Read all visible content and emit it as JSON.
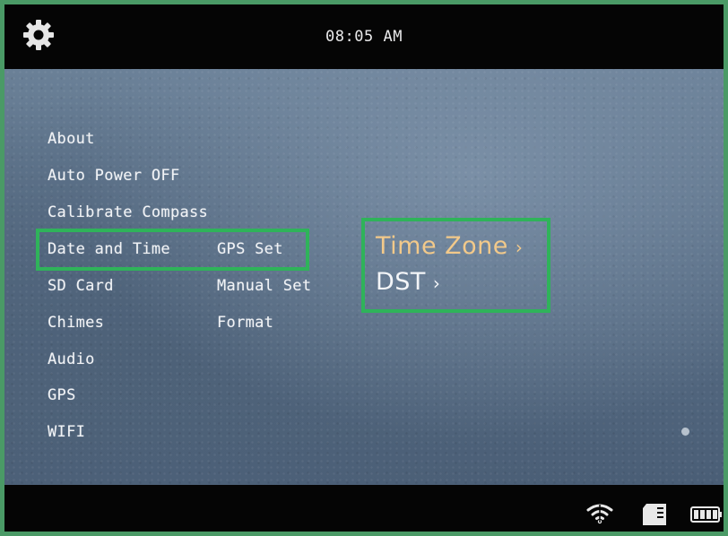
{
  "status_bar": {
    "time": "08:05 AM",
    "settings_icon": "gear-icon"
  },
  "menu": {
    "items": [
      {
        "label": "About"
      },
      {
        "label": "Auto Power OFF"
      },
      {
        "label": "Calibrate Compass"
      },
      {
        "label": "Date and Time",
        "selected": true
      },
      {
        "label": "SD Card"
      },
      {
        "label": "Chimes"
      },
      {
        "label": "Audio"
      },
      {
        "label": "GPS"
      },
      {
        "label": "WIFI"
      }
    ]
  },
  "submenu": {
    "items": [
      {
        "label": "GPS Set",
        "selected": true
      },
      {
        "label": "Manual Set"
      },
      {
        "label": "Format"
      }
    ]
  },
  "options": {
    "items": [
      {
        "label": "Time Zone",
        "chevron": "›",
        "color": "#f2c98a"
      },
      {
        "label": "DST",
        "chevron": "›",
        "color": "#f3f5f8"
      }
    ]
  },
  "bottom_bar": {
    "icons": [
      "wifi-icon",
      "sd-card-icon",
      "battery-icon"
    ]
  },
  "colors": {
    "highlight": "#2fb35a",
    "frame": "#4a9a66"
  }
}
